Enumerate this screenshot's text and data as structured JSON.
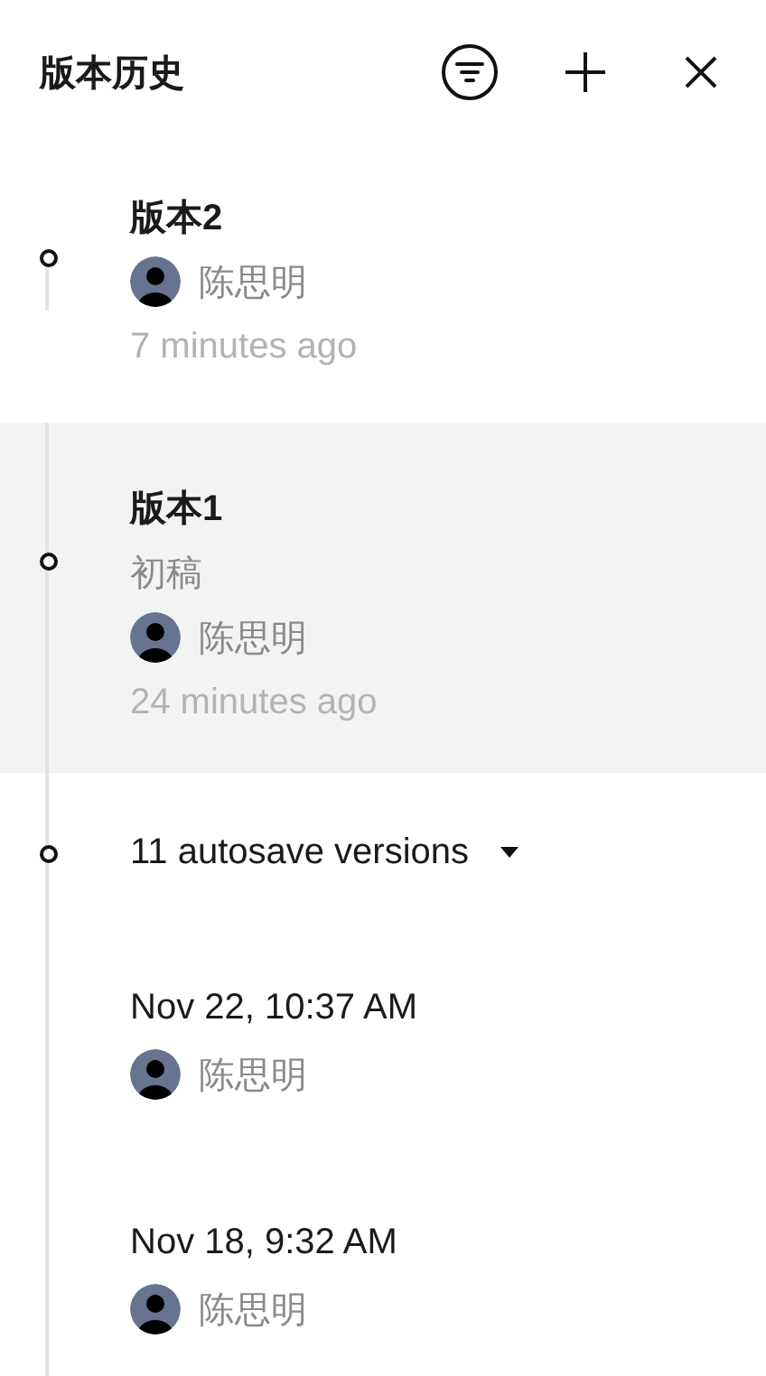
{
  "panel": {
    "title": "版本历史"
  },
  "versions": [
    {
      "name": "版本2",
      "author": "陈思明",
      "time": "7 minutes ago",
      "selected": false
    },
    {
      "name": "版本1",
      "description": "初稿",
      "author": "陈思明",
      "time": "24 minutes ago",
      "selected": true
    }
  ],
  "autosave": {
    "label": "11 autosave versions",
    "expanded": true,
    "items": [
      {
        "time": "Nov 22, 10:37 AM",
        "author": "陈思明"
      },
      {
        "time": "Nov 18, 9:32 AM",
        "author": "陈思明"
      }
    ]
  }
}
